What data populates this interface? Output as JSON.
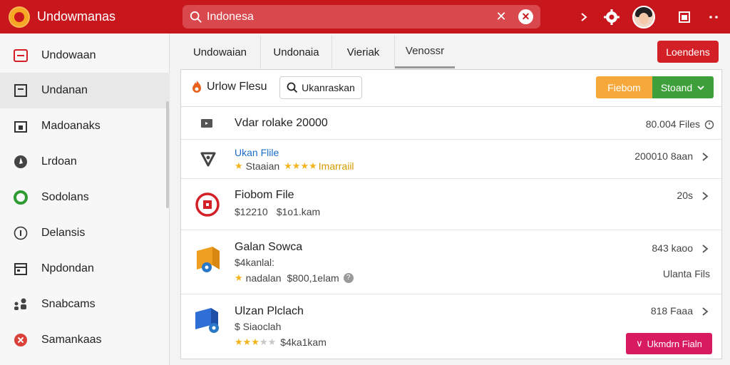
{
  "app": {
    "title": "Undowmanas"
  },
  "search": {
    "value": "Indonesa"
  },
  "sidebar": {
    "items": [
      {
        "label": "Undowaan",
        "icon": "inbox-icon"
      },
      {
        "label": "Undanan",
        "icon": "document-icon"
      },
      {
        "label": "Madoanaks",
        "icon": "folder-icon"
      },
      {
        "label": "Lrdoan",
        "icon": "compass-icon"
      },
      {
        "label": "Sodolans",
        "icon": "green-circle-icon"
      },
      {
        "label": "Delansis",
        "icon": "info-icon"
      },
      {
        "label": "Npdondan",
        "icon": "calendar-icon"
      },
      {
        "label": "Snabcams",
        "icon": "users-icon"
      },
      {
        "label": "Samankaas",
        "icon": "close-circle-icon"
      }
    ]
  },
  "tabs": [
    {
      "label": "Undowaian"
    },
    {
      "label": "Undonaia"
    },
    {
      "label": "Vieriak"
    },
    {
      "label": "Venossr"
    }
  ],
  "header": {
    "login_label": "Loendens"
  },
  "toolbar": {
    "upload_label": "Urlow Flesu",
    "search_label": "Ukanraskan",
    "filter_label": "Fiebom",
    "status_label": "Stoand"
  },
  "rows": [
    {
      "title": "Vdar rolake 20000",
      "meta": "80.004 Files"
    },
    {
      "title": "Ukan Flile",
      "sub_a": "Staaian",
      "sub_b": "Imarraiil",
      "meta": "200010 8aan",
      "rating": 4
    },
    {
      "title": "Fiobom File",
      "sub_a": "$12210",
      "sub_b": "$1o1.kam",
      "meta": "20s"
    },
    {
      "title": "Galan Sowca",
      "sub_a": "$4kanlal:",
      "sub_b": "nadalan",
      "sub_c": "$800,1elam",
      "meta": "843 kaoo",
      "meta2": "Ulanta Fils",
      "rating": 1
    },
    {
      "title": "Ulzan Plclach",
      "sub_a": "$ Siaoclah",
      "sub_b": "$4ka1kam",
      "meta": "818 Faaa",
      "action_label": "Ukmdrn Fialn",
      "rating": 3
    }
  ]
}
